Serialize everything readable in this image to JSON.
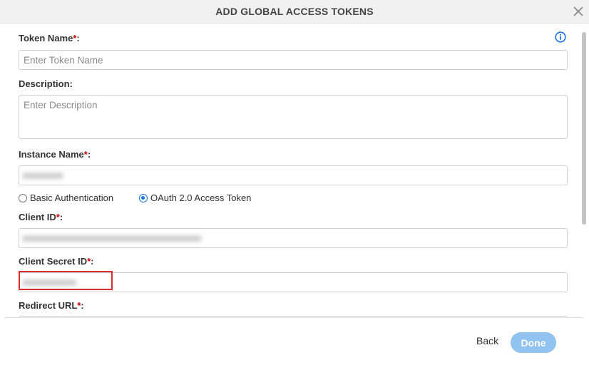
{
  "dialog": {
    "title": "ADD GLOBAL ACCESS TOKENS"
  },
  "form": {
    "token_name": {
      "label": "Token Name",
      "required_mark": "*",
      "suffix": ":",
      "placeholder": "Enter Token Name"
    },
    "description": {
      "label": "Description:",
      "placeholder": "Enter Description"
    },
    "instance_name": {
      "label": "Instance Name",
      "required_mark": "*",
      "suffix": ":",
      "value": "xxxxxxxxx"
    },
    "auth_options": [
      {
        "label": "Basic Authentication",
        "selected": false
      },
      {
        "label": "OAuth 2.0 Access Token",
        "selected": true
      }
    ],
    "client_id": {
      "label": "Client ID",
      "required_mark": "*",
      "suffix": ":",
      "value": "xxxxxxxxxxxxxxxxxxxxxxxxxxxxxxxxxxxxxxxx"
    },
    "client_secret_id": {
      "label": "Client Secret ID",
      "required_mark": "*",
      "suffix": ":",
      "value": "xxxxxxxxxxxx"
    },
    "redirect_url": {
      "label": "Redirect URL",
      "required_mark": "*",
      "suffix": ":"
    }
  },
  "footer": {
    "back_label": "Back",
    "done_label": "Done"
  },
  "icons": {
    "close": "close-icon",
    "info": "info-icon"
  },
  "colors": {
    "required": "#cc0000",
    "primary": "#1a73e8",
    "done_button": "#90c3ef",
    "highlight": "#d63030"
  }
}
